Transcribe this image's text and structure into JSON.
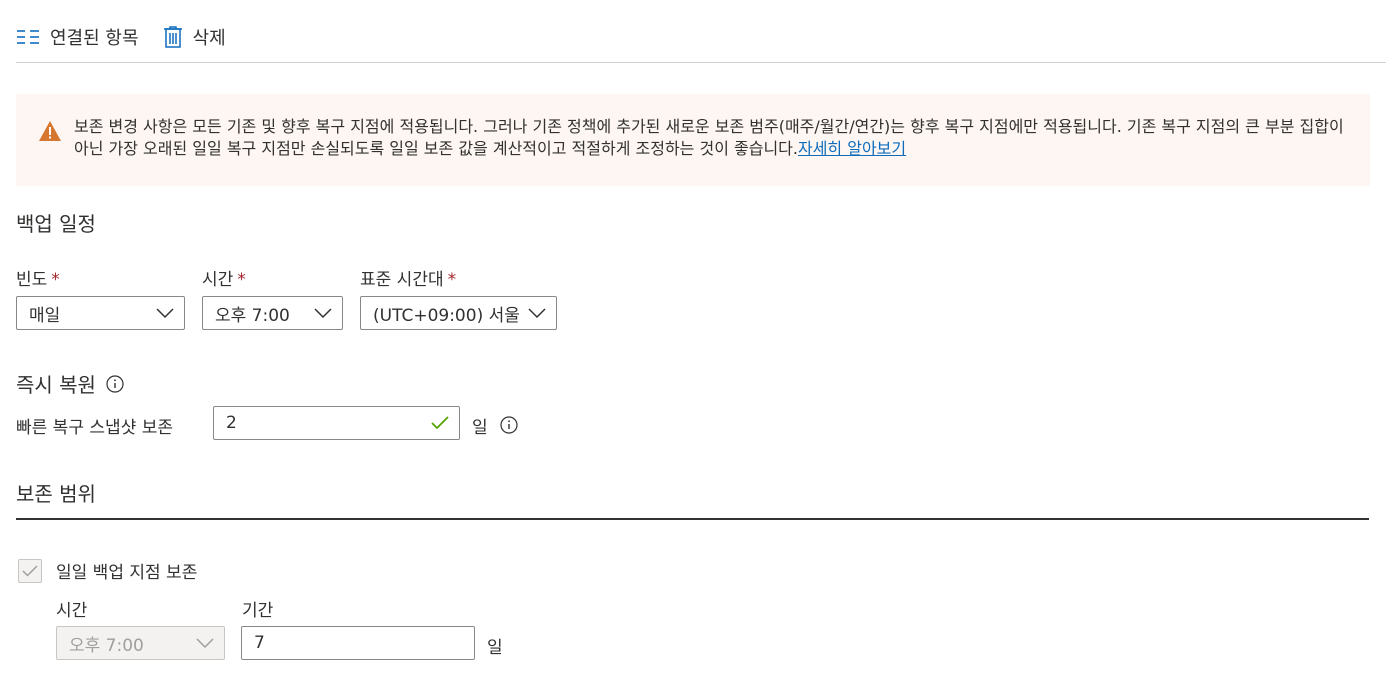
{
  "toolbar": {
    "linked_items_label": "연결된 항목",
    "delete_label": "삭제"
  },
  "warning": {
    "text": "보존 변경 사항은 모든 기존 및 향후 복구 지점에 적용됩니다. 그러나 기존 정책에 추가된 새로운 보존 범주(매주/월간/연간)는 향후 복구 지점에만 적용됩니다. 기존 복구 지점의 큰 부분 집합이 아닌 가장 오래된 일일 복구 지점만 손실되도록 일일 보존 값을 계산적이고 적절하게 조정하는 것이 좋습니다.",
    "link_text": "자세히 알아보기"
  },
  "backup_schedule": {
    "heading": "백업 일정",
    "frequency": {
      "label": "빈도",
      "required_mark": "*",
      "value": "매일"
    },
    "time": {
      "label": "시간",
      "required_mark": "*",
      "value": "오후 7:00"
    },
    "timezone": {
      "label": "표준 시간대",
      "required_mark": "*",
      "value": "(UTC+09:00) 서울"
    }
  },
  "instant_restore": {
    "heading": "즉시 복원",
    "snapshot_label": "빠른 복구 스냅샷 보존",
    "snapshot_value": "2",
    "unit": "일"
  },
  "retention_range": {
    "heading": "보존 범위",
    "daily": {
      "checkbox_label": "일일 백업 지점 보존",
      "checked": true,
      "time_label": "시간",
      "time_value": "오후 7:00",
      "duration_label": "기간",
      "duration_value": "7",
      "unit": "일"
    }
  },
  "colors": {
    "accent": "#0f6cbd",
    "warning_bg": "#fdf6f2",
    "warning_icon": "#d67730",
    "required": "#a4262c",
    "valid_check": "#57a300"
  }
}
